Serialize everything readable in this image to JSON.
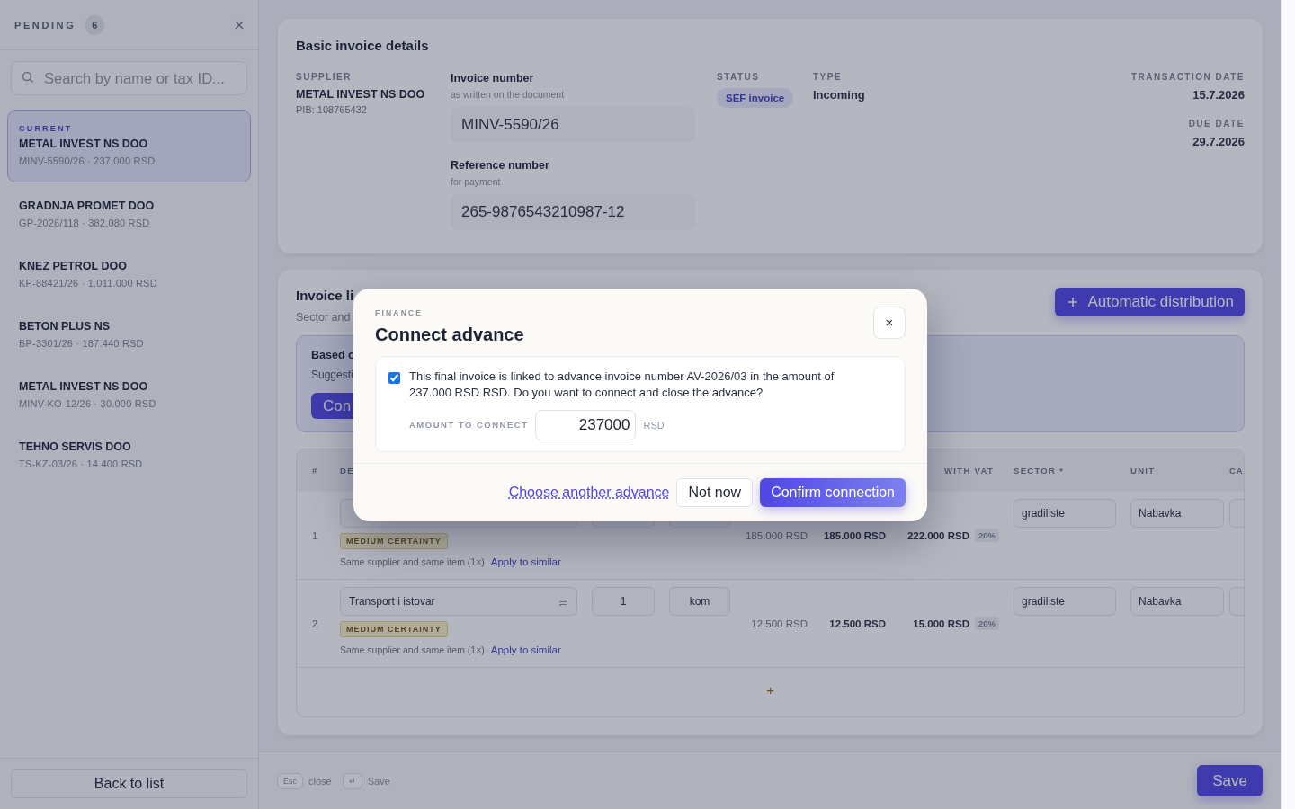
{
  "sidebar": {
    "title": "PENDING",
    "count": "6",
    "search": {
      "placeholder": "Search by name or tax ID..."
    },
    "items": [
      {
        "tag": "CURRENT",
        "name": "METAL INVEST NS DOO",
        "meta": "MINV-5590/26 · 237.000 RSD",
        "selected": true
      },
      {
        "name": "GRADNJA PROMET DOO",
        "meta": "GP-2026/118 · 382.080 RSD",
        "selected": false
      },
      {
        "name": "KNEZ PETROL DOO",
        "meta": "KP-88421/26 · 1.011.000 RSD",
        "selected": false
      },
      {
        "name": "BETON PLUS NS",
        "meta": "BP-3301/26 · 187.440 RSD",
        "selected": false
      },
      {
        "name": "METAL INVEST NS DOO",
        "meta": "MINV-KO-12/26 · 30.000 RSD",
        "selected": false
      },
      {
        "name": "TEHNO SERVIS DOO",
        "meta": "TS-KZ-03/26 · 14.400 RSD",
        "selected": false
      }
    ],
    "back_button": "Back to list"
  },
  "details": {
    "title": "Basic invoice details",
    "supplier": {
      "label": "SUPPLIER",
      "name": "METAL INVEST NS DOO",
      "pib": "PIB: 108765432"
    },
    "fields": [
      {
        "label": "Invoice number",
        "hint": "as written on the document",
        "value": "MINV-5590/26"
      },
      {
        "label": "Reference number",
        "hint": "for payment",
        "value": "265-9876543210987-12"
      }
    ],
    "status": {
      "label": "STATUS",
      "badge": "SEF invoice"
    },
    "type": {
      "label": "TYPE",
      "value": "Incoming"
    },
    "dates": [
      {
        "label": "TRANSACTION DATE",
        "value": "15.7.2026"
      },
      {
        "label": "DUE DATE",
        "value": "29.7.2026"
      }
    ]
  },
  "distribution": {
    "title": "Invoice li",
    "subtitle": "Sector and",
    "auto_button": "Automatic distribution",
    "suggestion": {
      "title": "Based o",
      "text": "Suggesti",
      "button": "Con"
    },
    "columns": [
      {
        "label": "#"
      },
      {
        "label": "DE"
      },
      {},
      {},
      {},
      {},
      {
        "label": "WITH VAT"
      },
      {
        "label": "SECTOR *"
      },
      {
        "label": "UNIT"
      },
      {
        "label": "CA"
      }
    ],
    "rows": [
      {
        "number": "1",
        "certainty": "MEDIUM CERTAINTY",
        "hint": "Same supplier and same item (1×)",
        "link": "Apply to similar",
        "price": "185.000 RSD",
        "net": "185.000 RSD",
        "gross": "222.000 RSD",
        "vat": "20%",
        "sector": "gradiliste",
        "unit2": "Nabavka"
      },
      {
        "number": "2",
        "description": "Transport i istovar",
        "swap_icon": true,
        "certainty": "MEDIUM CERTAINTY",
        "hint": "Same supplier and same item (1×)",
        "link": "Apply to similar",
        "qty": "1",
        "unit": "kom",
        "price": "12.500 RSD",
        "net": "12.500 RSD",
        "gross": "15.000 RSD",
        "vat": "20%",
        "sector": "gradiliste",
        "unit2": "Nabavka"
      }
    ],
    "add_button": "+"
  },
  "footer": {
    "hints": [
      {
        "key": "Esc",
        "label": "close"
      },
      {
        "key": "↵",
        "label": "Save"
      }
    ],
    "save_button": "Save"
  },
  "modal": {
    "eyebrow": "FINANCE",
    "title": "Connect advance",
    "close": "×",
    "checked": true,
    "text": "This final invoice is linked to advance invoice number AV-2026/03 in the amount of 237.000 RSD RSD. Do you want to connect and close the advance?",
    "amount_label": "AMOUNT TO CONNECT",
    "amount": "237000",
    "currency": "RSD",
    "link": "Choose another advance",
    "secondary": "Not now",
    "primary": "Confirm connection"
  }
}
